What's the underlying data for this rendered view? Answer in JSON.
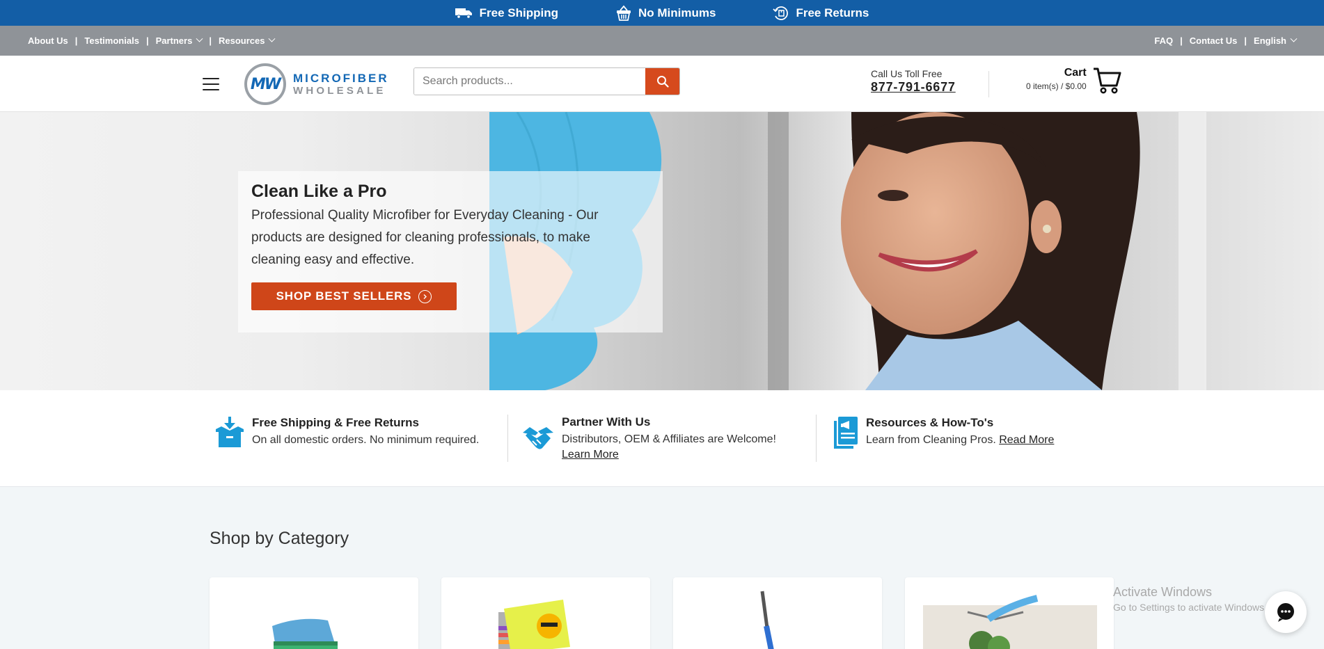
{
  "promo_bar": {
    "items": [
      {
        "label": "Free Shipping",
        "icon": "truck-icon"
      },
      {
        "label": "No Minimums",
        "icon": "basket-icon"
      },
      {
        "label": "Free Returns",
        "icon": "return-icon"
      }
    ]
  },
  "utility_nav": {
    "left": [
      "About Us",
      "Testimonials",
      "Partners",
      "Resources"
    ],
    "right": [
      "FAQ",
      "Contact Us",
      "English"
    ]
  },
  "header": {
    "logo": {
      "mark": "MW",
      "line1": "MICROFIBER",
      "line2": "WHOLESALE"
    },
    "search_placeholder": "Search products...",
    "call_label": "Call Us Toll Free",
    "phone": "877-791-6677",
    "cart_label": "Cart",
    "cart_summary": "0 item(s) / $0.00"
  },
  "hero": {
    "title": "Clean Like a Pro",
    "description": "Professional Quality Microfiber for Everyday Cleaning - Our products are designed for cleaning professionals, to make cleaning easy and effective.",
    "cta": "SHOP BEST SELLERS"
  },
  "benefits": [
    {
      "title": "Free Shipping & Free Returns",
      "text": "On all domestic orders. No minimum required.",
      "link": "",
      "icon": "box-download-icon"
    },
    {
      "title": "Partner With Us",
      "text": "Distributors, OEM & Affiliates are Welcome!",
      "link": "Learn More",
      "icon": "handshake-icon"
    },
    {
      "title": "Resources & How-To's",
      "text": "Learn from Cleaning Pros.",
      "link": "Read More",
      "icon": "document-megaphone-icon"
    }
  ],
  "shop": {
    "title": "Shop by Category"
  },
  "watermark": {
    "line1": "Activate Windows",
    "line2": "Go to Settings to activate Windows."
  },
  "colors": {
    "brand_blue": "#135ea6",
    "accent_orange": "#cf4619",
    "utility_gray": "#8f9398"
  }
}
